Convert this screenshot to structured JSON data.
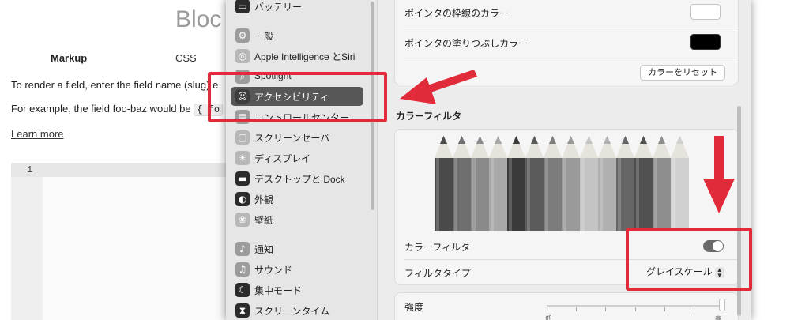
{
  "background_page": {
    "title": "Bloc",
    "tabs": [
      "Markup",
      "CSS"
    ],
    "line1": "To render a field, enter the field name (slug) e",
    "line2_prefix": "For example, the field foo-baz would be ",
    "line2_code": "{ fo",
    "learn_more": "Learn more",
    "editor_line_number": "1"
  },
  "sidebar": {
    "items": [
      {
        "label": "バッテリー",
        "icon": "battery-icon"
      },
      {
        "label": "一般",
        "icon": "gear-icon"
      },
      {
        "label": "Apple Intelligence とSiri",
        "icon": "siri-icon"
      },
      {
        "label": "Spotlight",
        "icon": "search-icon"
      },
      {
        "label": "アクセシビリティ",
        "icon": "accessibility-icon",
        "selected": true
      },
      {
        "label": "コントロールセンター",
        "icon": "control-center-icon"
      },
      {
        "label": "スクリーンセーバ",
        "icon": "screensaver-icon"
      },
      {
        "label": "ディスプレイ",
        "icon": "display-icon"
      },
      {
        "label": "デスクトップと Dock",
        "icon": "dock-icon"
      },
      {
        "label": "外観",
        "icon": "appearance-icon"
      },
      {
        "label": "壁紙",
        "icon": "wallpaper-icon"
      },
      {
        "label": "通知",
        "icon": "bell-icon"
      },
      {
        "label": "サウンド",
        "icon": "speaker-icon"
      },
      {
        "label": "集中モード",
        "icon": "moon-icon"
      },
      {
        "label": "スクリーンタイム",
        "icon": "hourglass-icon"
      }
    ]
  },
  "main": {
    "pointer_outline_label": "ポインタの枠線のカラー",
    "pointer_fill_label": "ポインタの塗りつぶしカラー",
    "reset_colors_button": "カラーをリセット",
    "color_filters_title": "カラーフィルタ",
    "color_filter_toggle_label": "カラーフィルタ",
    "color_filter_enabled": true,
    "filter_type_label": "フィルタタイプ",
    "filter_type_value": "グレイスケール",
    "intensity_label": "強度",
    "intensity_min": "低",
    "intensity_max": "高",
    "intensity_level": 1.0
  },
  "colors": {
    "outline_swatch": "#ffffff",
    "fill_swatch": "#000000",
    "annotation": "#e12b3b"
  }
}
